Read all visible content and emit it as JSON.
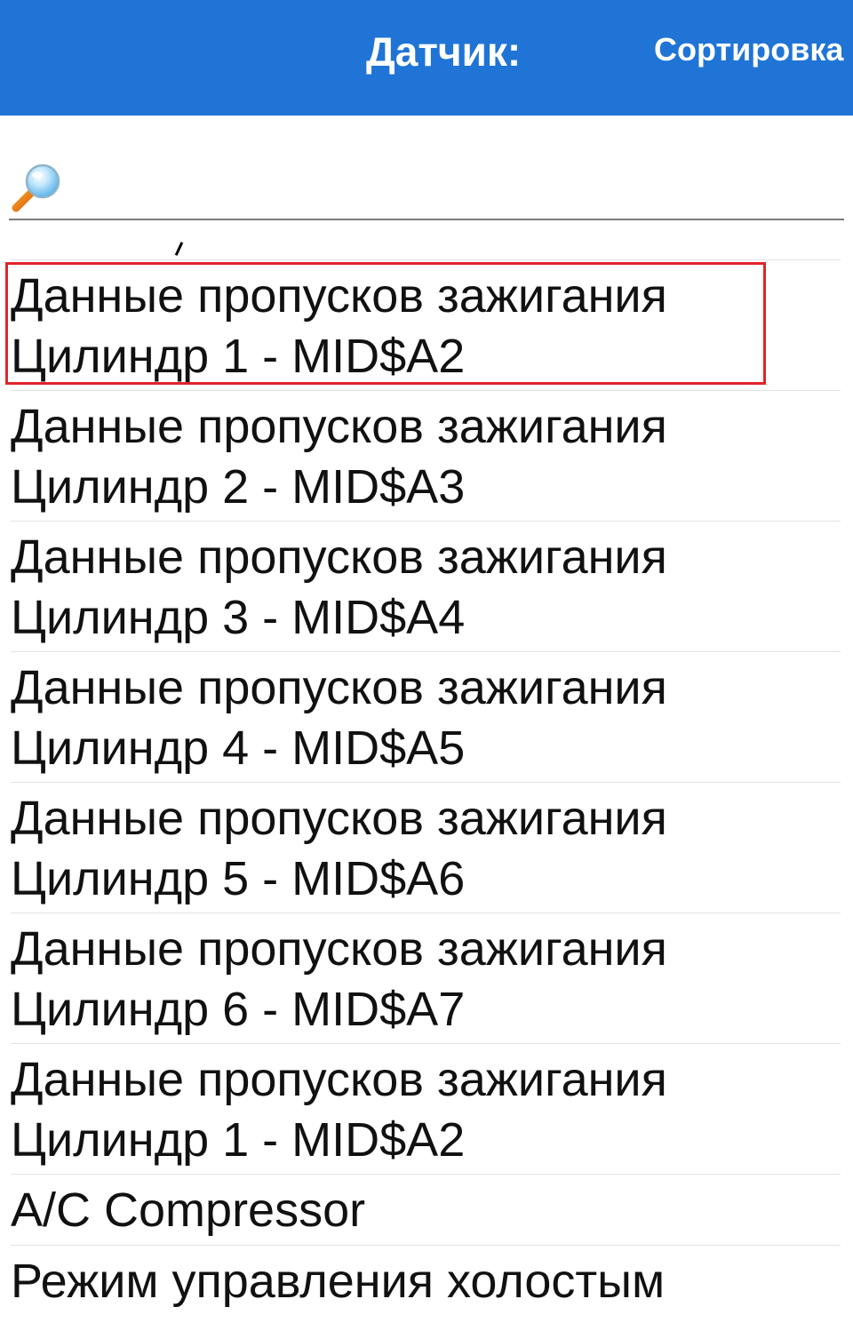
{
  "header": {
    "title": "Датчик:",
    "sort_label": "Сортировка",
    "background": "#1f74d6"
  },
  "search": {
    "icon": "search-icon",
    "value": "",
    "placeholder": ""
  },
  "list": {
    "items": [
      {
        "line1": "Данные пропусков зажигания",
        "line2": "Цилиндр 1 - MID$A2",
        "selected": true
      },
      {
        "line1": "Данные пропусков зажигания",
        "line2": "Цилиндр 2 - MID$A3"
      },
      {
        "line1": "Данные пропусков зажигания",
        "line2": "Цилиндр 3 - MID$A4"
      },
      {
        "line1": "Данные пропусков зажигания",
        "line2": "Цилиндр 4 - MID$A5"
      },
      {
        "line1": "Данные пропусков зажигания",
        "line2": "Цилиндр 5 - MID$A6"
      },
      {
        "line1": "Данные пропусков зажигания",
        "line2": "Цилиндр 6 - MID$A7"
      },
      {
        "line1": "Данные пропусков зажигания",
        "line2": "Цилиндр 1 - MID$A2"
      },
      {
        "line1": "A/C Compressor"
      },
      {
        "line1": "Режим управления холостым"
      }
    ]
  },
  "colors": {
    "highlight": "#e0242b",
    "divider": "#e2e2e2"
  }
}
